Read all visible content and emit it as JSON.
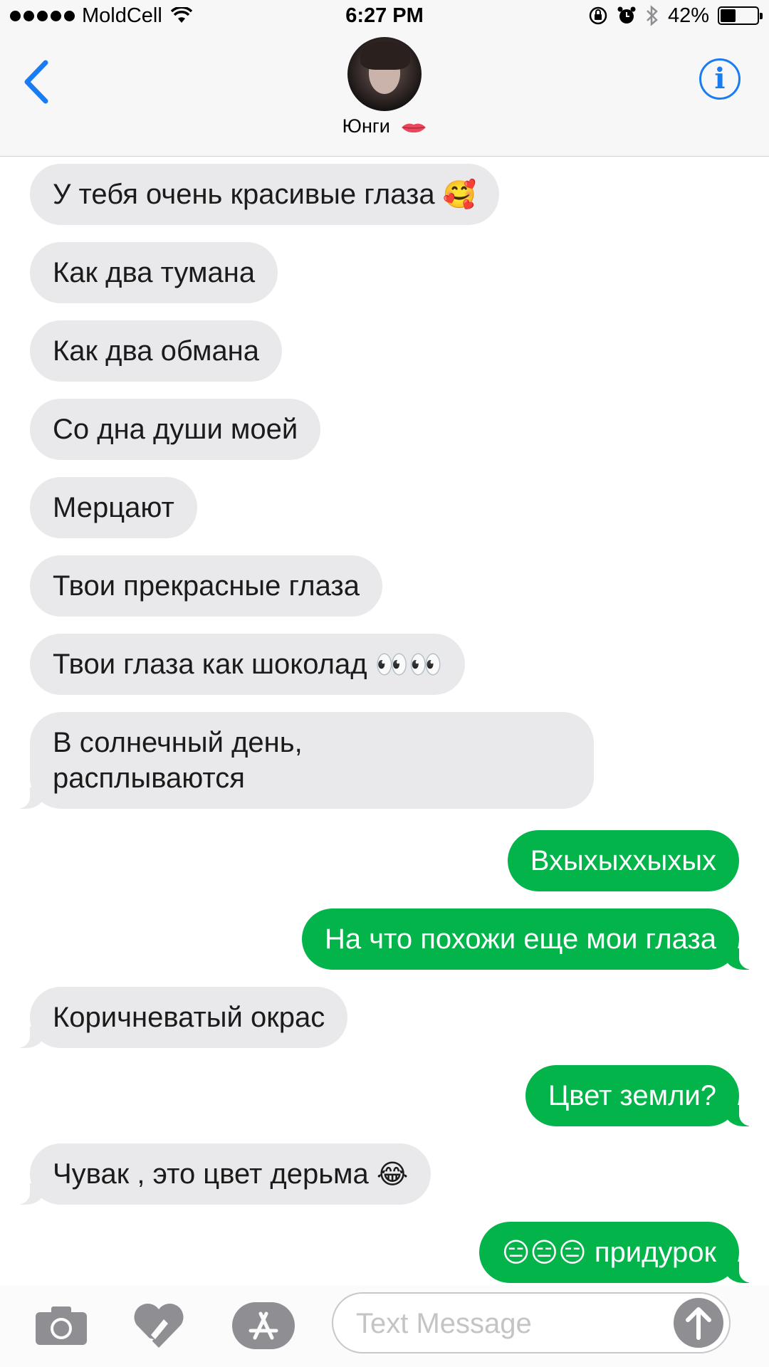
{
  "status_bar": {
    "carrier": "MoldCell",
    "time": "6:27 PM",
    "battery_percent": "42%",
    "battery_level": 0.42,
    "icons": [
      "signal-dots",
      "wifi-icon",
      "orientation-lock-icon",
      "alarm-icon",
      "bluetooth-icon",
      "battery-icon"
    ]
  },
  "header": {
    "contact_name": "Юнги",
    "contact_emoji": "lips-icon",
    "back_icon": "chevron-left-icon",
    "info_label": "i"
  },
  "messages": [
    {
      "dir": "in",
      "text": "У тебя очень красивые глаза",
      "emoji": "🥰"
    },
    {
      "dir": "in",
      "text": "Как два тумана"
    },
    {
      "dir": "in",
      "text": "Как два обмана"
    },
    {
      "dir": "in",
      "text": "Со дна души моей"
    },
    {
      "dir": "in",
      "text": "Мерцают"
    },
    {
      "dir": "in",
      "text": "Твои прекрасные глаза"
    },
    {
      "dir": "in",
      "text": "Твои глаза как шоколад",
      "emoji": "👀👀"
    },
    {
      "dir": "in",
      "line1": "В солнечный день,",
      "line2": "расплываются"
    },
    {
      "dir": "out",
      "text": "Вхыхыххыхых"
    },
    {
      "dir": "out",
      "text": "На что похожи еще мои глаза"
    },
    {
      "dir": "in",
      "text": "Коричневатый окрас"
    },
    {
      "dir": "out",
      "text": "Цвет земли?"
    },
    {
      "dir": "in",
      "text": "Чувак , это цвет дерьма",
      "emoji": "😂"
    },
    {
      "dir": "out",
      "emoji": "😑😑😑",
      "text": "придурок"
    }
  ],
  "input_bar": {
    "placeholder": "Text Message",
    "value": "",
    "icons": [
      "camera-icon",
      "digital-touch-heart-icon",
      "app-store-icon",
      "send-arrow-icon"
    ]
  },
  "colors": {
    "incoming_bubble": "#e9e9eb",
    "outgoing_bubble": "#02b449",
    "accent_blue": "#1a7cf2",
    "send_button": "#8e8e93"
  }
}
